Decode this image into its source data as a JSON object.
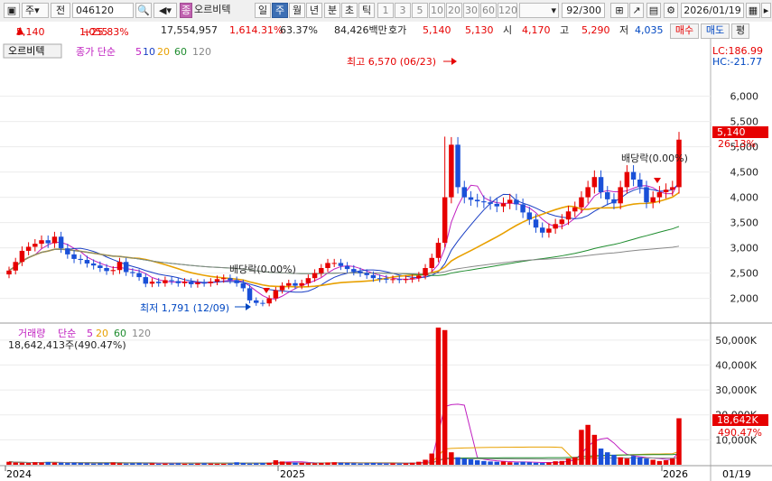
{
  "toolbar": {
    "mode": "주",
    "kind": "전",
    "code": "046120",
    "badge": "종",
    "name": "오르비텍",
    "periods": [
      "일",
      "주",
      "월",
      "년",
      "분",
      "초",
      "틱"
    ],
    "active_period": "주",
    "numbers": [
      "1",
      "3",
      "5",
      "10",
      "20",
      "30",
      "60",
      "120"
    ],
    "count": "92/300",
    "date": "2026/01/19"
  },
  "quote": {
    "price": "5,140",
    "change": "1,055",
    "change_pct": "+25.83%",
    "volume": "17,554,957",
    "vol_pct": "1,614.31%",
    "turnover": "63.37%",
    "amount": "84,426백만",
    "hoga_label": "호가",
    "ask": "5,140",
    "bid": "5,130",
    "open_label": "시",
    "open": "4,170",
    "high_label": "고",
    "high": "5,290",
    "low_label": "저",
    "low": "4,035",
    "buy_label": "매수",
    "sell_label": "매도",
    "flat_label": "평"
  },
  "price_panel": {
    "tab": "오르비텍",
    "legend_prefix": "종가 단순",
    "ma_labels": [
      "5",
      "10",
      "20",
      "60",
      "120"
    ],
    "ma_colors": [
      "#c020c0",
      "#1a3fc4",
      "#e8a000",
      "#1e8c2e",
      "#888888"
    ],
    "lc": "LC:186.99",
    "hc": "HC:-21.77",
    "price_tag": "5,140",
    "price_tag_pct": "26.13%",
    "annot_high": "최고 6,570 (06/23)",
    "annot_low": "최저 1,791 (12/09)",
    "annot_div1": "배당락(0.00%)",
    "annot_div2": "배당락(0.00%)"
  },
  "volume_panel": {
    "label": "거래량",
    "legend_prefix": "단순",
    "ma_labels": [
      "5",
      "20",
      "60",
      "120"
    ],
    "ma_colors": [
      "#c020c0",
      "#e8a000",
      "#1e8c2e",
      "#888888"
    ],
    "value_line": "18,642,413주(490.47%)",
    "tag_value": "18,642K",
    "tag_pct": "490.47%"
  },
  "axis": {
    "x_labels": [
      "2024",
      "2025",
      "2026"
    ],
    "date_right": "01/19"
  },
  "chart_data": {
    "type": "candlestick",
    "y_ticks": [
      "2,000",
      "2,500",
      "3,000",
      "3,500",
      "4,000",
      "4,500",
      "5,000",
      "5,500",
      "6,000"
    ],
    "y_tick_values": [
      2000,
      2500,
      3000,
      3500,
      4000,
      4500,
      5000,
      5500,
      6000
    ],
    "ylim": [
      1600,
      6600
    ],
    "vol_ticks": [
      "10,000K",
      "20,000K",
      "30,000K",
      "40,000K",
      "50,000K"
    ],
    "vol_tick_values": [
      10000,
      20000,
      30000,
      40000,
      50000
    ],
    "vol_ylim": [
      0,
      55000
    ],
    "closes": [
      2550,
      2720,
      2940,
      3020,
      3080,
      3150,
      3090,
      3220,
      2990,
      2870,
      2780,
      2760,
      2690,
      2650,
      2600,
      2540,
      2560,
      2720,
      2520,
      2500,
      2420,
      2290,
      2330,
      2300,
      2360,
      2340,
      2300,
      2330,
      2280,
      2310,
      2300,
      2330,
      2380,
      2400,
      2360,
      2300,
      2200,
      1960,
      1910,
      1900,
      2000,
      2160,
      2250,
      2300,
      2250,
      2300,
      2400,
      2500,
      2600,
      2700,
      2700,
      2640,
      2580,
      2530,
      2500,
      2460,
      2400,
      2390,
      2370,
      2380,
      2370,
      2380,
      2400,
      2450,
      2600,
      2800,
      3100,
      4000,
      5040,
      4200,
      4000,
      3950,
      3920,
      3900,
      3870,
      3820,
      3880,
      3950,
      3860,
      3700,
      3560,
      3400,
      3300,
      3380,
      3470,
      3560,
      3720,
      3800,
      4000,
      4200,
      4400,
      4100,
      3960,
      3880,
      4200,
      4500,
      4350,
      4200,
      3900,
      4000,
      4100,
      4150,
      4200,
      5140
    ],
    "volumes": [
      1200,
      900,
      800,
      700,
      1000,
      900,
      1100,
      900,
      800,
      700,
      800,
      700,
      600,
      500,
      600,
      700,
      900,
      600,
      500,
      600,
      700,
      500,
      600,
      400,
      500,
      500,
      600,
      400,
      400,
      500,
      600,
      500,
      400,
      400,
      500,
      1000,
      700,
      500,
      600,
      700,
      800,
      1800,
      1300,
      1000,
      900,
      800,
      700,
      600,
      700,
      900,
      1000,
      800,
      700,
      600,
      500,
      600,
      700,
      600,
      500,
      600,
      500,
      600,
      800,
      1200,
      2000,
      4500,
      55000,
      54000,
      5000,
      3000,
      2500,
      2200,
      1800,
      1500,
      1300,
      1200,
      1300,
      1000,
      900,
      1200,
      1000,
      800,
      700,
      900,
      1400,
      1500,
      2500,
      3000,
      14000,
      16000,
      12000,
      6500,
      5000,
      4000,
      3000,
      2500,
      3500,
      3000,
      2500,
      2000,
      1500,
      1800,
      2500,
      18642
    ],
    "annotations": [
      "최고 6,570 (06/23)",
      "최저 1,791 (12/09)",
      "배당락(0.00%)",
      "배당락(0.00%)"
    ]
  }
}
